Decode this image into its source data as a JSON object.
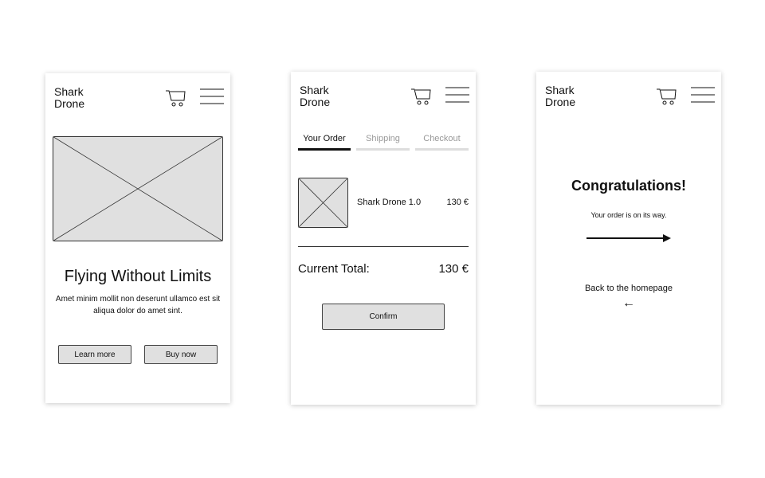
{
  "screen1": {
    "brand": "Shark\nDrone",
    "hero_title": "Flying Without Limits",
    "hero_subtitle": "Amet minim mollit non deserunt ullamco est sit aliqua dolor do amet sint.",
    "learn_more": "Learn more",
    "buy_now": "Buy now"
  },
  "screen2": {
    "brand": "Shark\nDrone",
    "tabs": [
      {
        "label": "Your Order",
        "active": true
      },
      {
        "label": "Shipping",
        "active": false
      },
      {
        "label": "Checkout",
        "active": false
      }
    ],
    "item": {
      "name": "Shark Drone 1.0",
      "price": "130 €"
    },
    "total_label": "Current Total:",
    "total_value": "130 €",
    "confirm": "Confirm"
  },
  "screen3": {
    "brand": "Shark\nDrone",
    "title": "Congratulations!",
    "subtitle": "Your order is on its way.",
    "back_link": "Back to the homepage",
    "back_arrow": "←"
  }
}
